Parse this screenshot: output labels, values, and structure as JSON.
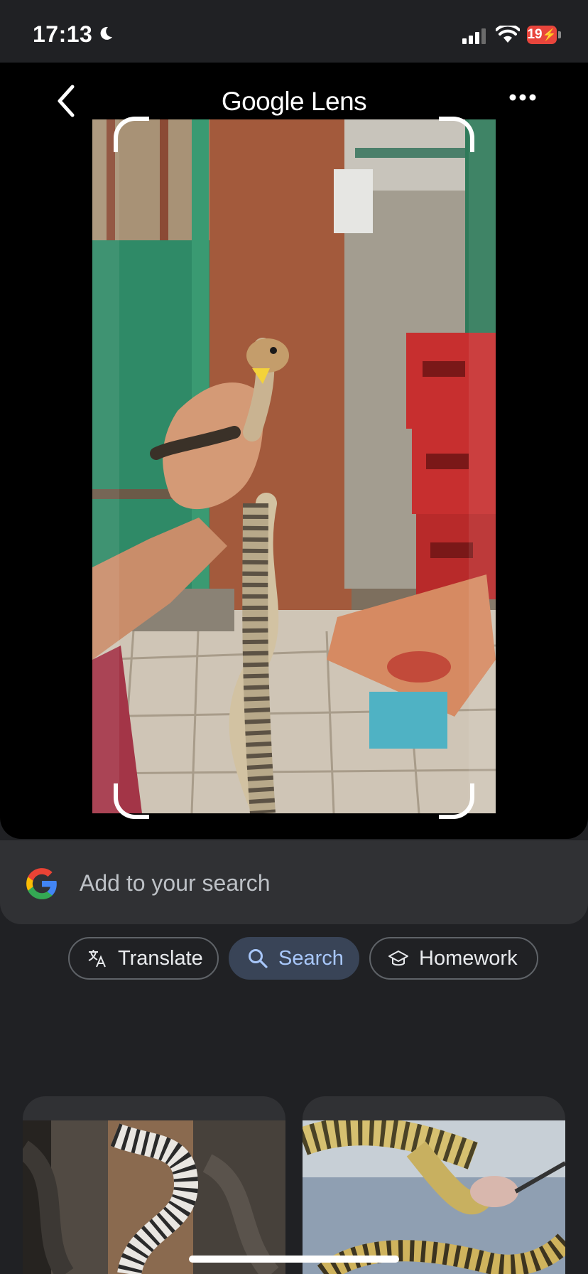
{
  "status_bar": {
    "time": "17:13",
    "battery": "19"
  },
  "lens": {
    "title_google": "Google",
    "title_lens": "Lens"
  },
  "search": {
    "placeholder": "Add to your search"
  },
  "chips": [
    {
      "label": "Translate",
      "icon": "translate-icon"
    },
    {
      "label": "Search",
      "icon": "search-icon",
      "selected": true
    },
    {
      "label": "Homework",
      "icon": "graduation-cap-icon"
    }
  ],
  "colors": {
    "background": "#202124",
    "panel": "#303134",
    "selected_chip": "#394457",
    "selected_chip_text": "#a8c7fa",
    "battery": "#e8453c"
  }
}
